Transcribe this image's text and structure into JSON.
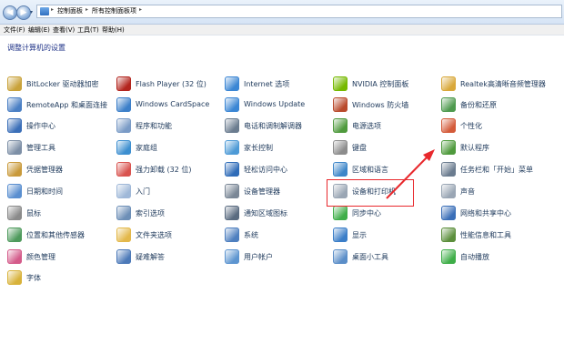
{
  "address_bar": {
    "crumbs": [
      "控制面板",
      "所有控制面板项"
    ],
    "back_glyph": "◀",
    "forward_glyph": "▶",
    "dropdown_glyph": "▾"
  },
  "menu": {
    "file": "文件(F)",
    "edit": "编辑(E)",
    "view": "查看(V)",
    "tools": "工具(T)",
    "help": "帮助(H)"
  },
  "page_title": "调整计算机的设置",
  "columns": [
    [
      {
        "label": "BitLocker 驱动器加密",
        "icon": "bitlocker-key-icon",
        "color": "#c9a23a"
      },
      {
        "label": "RemoteApp 和桌面连接",
        "icon": "remoteapp-icon",
        "color": "#4a7fc4"
      },
      {
        "label": "操作中心",
        "icon": "action-center-flag-icon",
        "color": "#3b6fb8"
      },
      {
        "label": "管理工具",
        "icon": "admin-tools-icon",
        "color": "#7d8fa6"
      },
      {
        "label": "凭据管理器",
        "icon": "credential-manager-icon",
        "color": "#c99a3b"
      },
      {
        "label": "日期和时间",
        "icon": "date-time-icon",
        "color": "#5a8fd0"
      },
      {
        "label": "鼠标",
        "icon": "mouse-icon",
        "color": "#8a8a8a"
      },
      {
        "label": "位置和其他传感器",
        "icon": "location-sensor-icon",
        "color": "#4e9a5c"
      },
      {
        "label": "颜色管理",
        "icon": "color-management-icon",
        "color": "#d45b8a"
      },
      {
        "label": "字体",
        "icon": "fonts-icon",
        "color": "#d8b23a"
      }
    ],
    [
      {
        "label": "Flash Player (32 位)",
        "icon": "flash-player-icon",
        "color": "#b3251e"
      },
      {
        "label": "Windows CardSpace",
        "icon": "cardspace-icon",
        "color": "#3c7fc9"
      },
      {
        "label": "程序和功能",
        "icon": "programs-features-icon",
        "color": "#7a9bc6"
      },
      {
        "label": "家庭组",
        "icon": "homegroup-icon",
        "color": "#3d8fd0"
      },
      {
        "label": "强力卸载 (32 位)",
        "icon": "uninstall-icon",
        "color": "#d9534f"
      },
      {
        "label": "入门",
        "icon": "getting-started-icon",
        "color": "#9fb8d8"
      },
      {
        "label": "索引选项",
        "icon": "indexing-options-icon",
        "color": "#6d8fb7"
      },
      {
        "label": "文件夹选项",
        "icon": "folder-options-icon",
        "color": "#e3b84a"
      },
      {
        "label": "疑难解答",
        "icon": "troubleshooting-icon",
        "color": "#4c79b8"
      }
    ],
    [
      {
        "label": "Internet 选项",
        "icon": "internet-options-icon",
        "color": "#3b86d4"
      },
      {
        "label": "Windows Update",
        "icon": "windows-update-icon",
        "color": "#3b86d4"
      },
      {
        "label": "电话和调制解调器",
        "icon": "phone-modem-icon",
        "color": "#6b7c8f"
      },
      {
        "label": "家长控制",
        "icon": "parental-controls-icon",
        "color": "#4d9ad6"
      },
      {
        "label": "轻松访问中心",
        "icon": "ease-of-access-icon",
        "color": "#2f6cb8"
      },
      {
        "label": "设备管理器",
        "icon": "device-manager-icon",
        "color": "#7a8796"
      },
      {
        "label": "通知区域图标",
        "icon": "notification-area-icon",
        "color": "#5a6b80"
      },
      {
        "label": "系统",
        "icon": "system-icon",
        "color": "#4e7fbf"
      },
      {
        "label": "用户帐户",
        "icon": "user-accounts-icon",
        "color": "#5d95d0"
      }
    ],
    [
      {
        "label": "NVIDIA 控制面板",
        "icon": "nvidia-icon",
        "color": "#76b900"
      },
      {
        "label": "Windows 防火墙",
        "icon": "firewall-icon",
        "color": "#b94a2c"
      },
      {
        "label": "电源选项",
        "icon": "power-options-icon",
        "color": "#4f9a3d"
      },
      {
        "label": "键盘",
        "icon": "keyboard-icon",
        "color": "#8c8c8c"
      },
      {
        "label": "区域和语言",
        "icon": "region-language-icon",
        "color": "#3d86c9"
      },
      {
        "label": "设备和打印机",
        "icon": "devices-printers-icon",
        "color": "#9aa6b4"
      },
      {
        "label": "同步中心",
        "icon": "sync-center-icon",
        "color": "#3fae49"
      },
      {
        "label": "显示",
        "icon": "display-icon",
        "color": "#3b7ec8"
      },
      {
        "label": "桌面小工具",
        "icon": "desktop-gadgets-icon",
        "color": "#5b8ec8"
      }
    ],
    [
      {
        "label": "Realtek高清晰音频管理器",
        "icon": "realtek-audio-icon",
        "color": "#d9a83a"
      },
      {
        "label": "备份和还原",
        "icon": "backup-restore-icon",
        "color": "#4e9a4e"
      },
      {
        "label": "个性化",
        "icon": "personalization-icon",
        "color": "#d45b3a"
      },
      {
        "label": "默认程序",
        "icon": "default-programs-icon",
        "color": "#4f9a3d"
      },
      {
        "label": "任务栏和「开始」菜单",
        "icon": "taskbar-start-icon",
        "color": "#6b7c8f"
      },
      {
        "label": "声音",
        "icon": "sound-icon",
        "color": "#9aa6b4"
      },
      {
        "label": "网络和共享中心",
        "icon": "network-sharing-icon",
        "color": "#3b6fb8"
      },
      {
        "label": "性能信息和工具",
        "icon": "performance-icon",
        "color": "#5c8f3c"
      },
      {
        "label": "自动播放",
        "icon": "autoplay-icon",
        "color": "#3fae49"
      }
    ]
  ],
  "colors": {
    "annotation": "#e8282c",
    "link": "#1e395b",
    "title": "#1e3287"
  }
}
